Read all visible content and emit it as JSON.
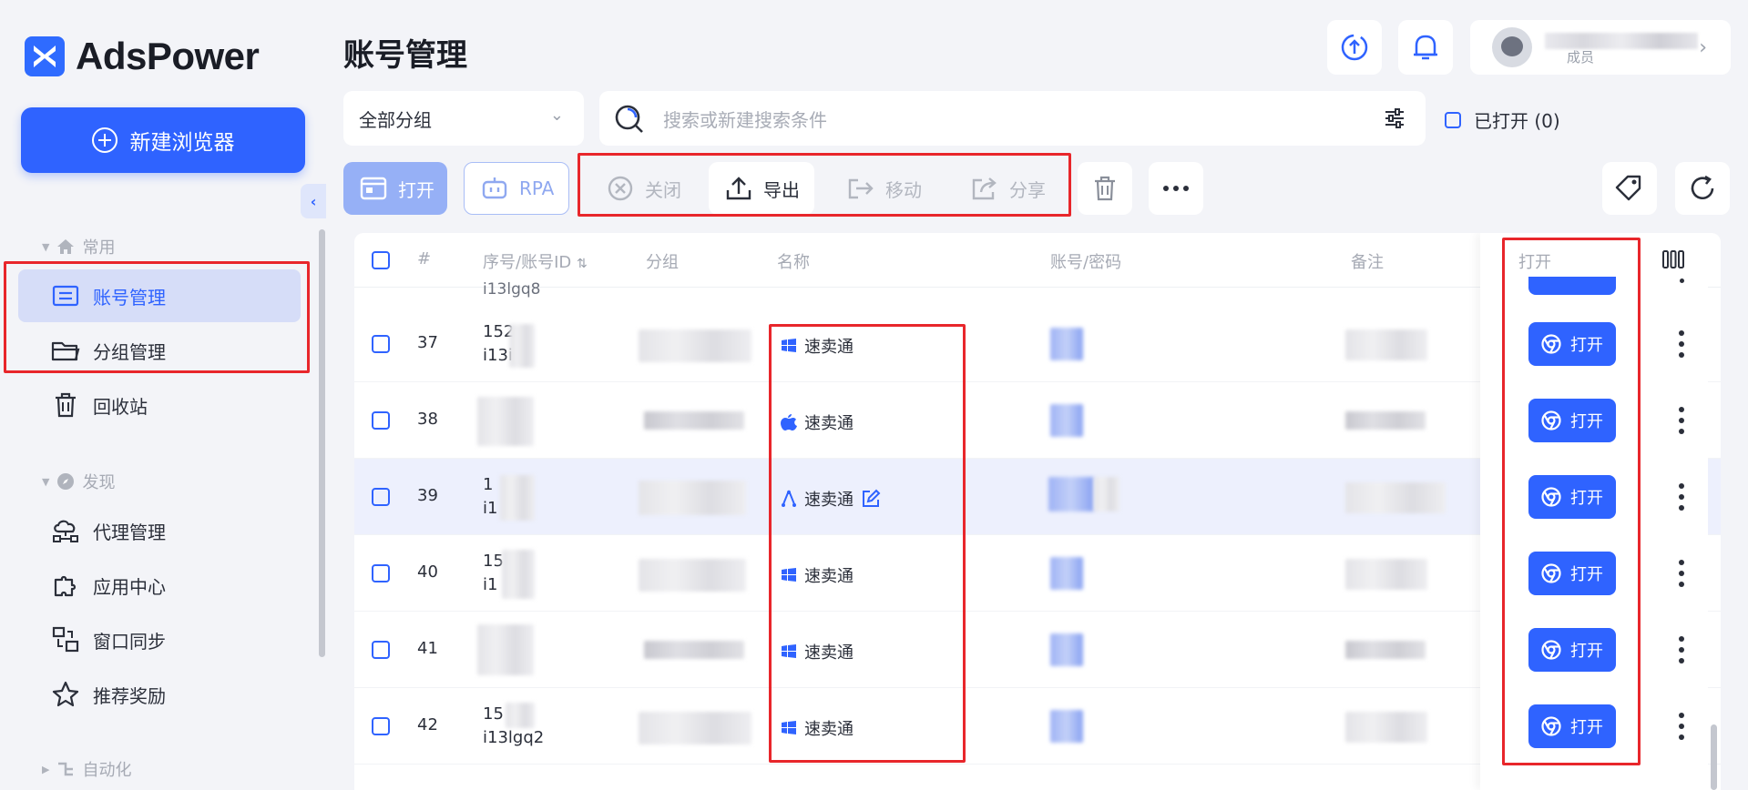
{
  "brand": {
    "name": "AdsPower",
    "accent": "#2f63ff"
  },
  "sidebar": {
    "new_browser_label": "新建浏览器",
    "sections": [
      {
        "title": "常用",
        "items": [
          {
            "label": "账号管理",
            "icon": "list-icon"
          },
          {
            "label": "分组管理",
            "icon": "folder-icon"
          },
          {
            "label": "回收站",
            "icon": "trash-icon"
          }
        ]
      },
      {
        "title": "发现",
        "items": [
          {
            "label": "代理管理",
            "icon": "cloud-network-icon"
          },
          {
            "label": "应用中心",
            "icon": "puzzle-icon"
          },
          {
            "label": "窗口同步",
            "icon": "sync-windows-icon"
          },
          {
            "label": "推荐奖励",
            "icon": "star-icon"
          }
        ]
      },
      {
        "title": "自动化",
        "items": []
      }
    ],
    "active_item": "账号管理"
  },
  "header": {
    "title": "账号管理",
    "user_partial": "成员"
  },
  "filters": {
    "group_select": "全部分组",
    "search_placeholder": "搜索或新建搜索条件",
    "opened_label": "已打开 (0)"
  },
  "toolbar": {
    "open": "打开",
    "rpa": "RPA",
    "close": "关闭",
    "export": "导出",
    "move": "移动",
    "share": "分享"
  },
  "table": {
    "headers": {
      "index": "#",
      "serial": "序号/账号ID",
      "group": "分组",
      "name": "名称",
      "account": "账号/密码",
      "remark": "备注",
      "open": "打开"
    },
    "partial_top_id": "i13lgq8",
    "rows": [
      {
        "index": "37",
        "serial": "152",
        "id": "i13i",
        "os": "windows",
        "name": "速卖通",
        "open": "打开"
      },
      {
        "index": "38",
        "serial": "",
        "id": "",
        "os": "apple",
        "name": "速卖通",
        "open": "打开"
      },
      {
        "index": "39",
        "serial": "1",
        "id": "i1",
        "os": "linux",
        "name": "速卖通",
        "open": "打开"
      },
      {
        "index": "40",
        "serial": "15",
        "id": "i1",
        "os": "windows",
        "name": "速卖通",
        "open": "打开"
      },
      {
        "index": "41",
        "serial": "",
        "id": "",
        "os": "windows",
        "name": "速卖通",
        "open": "打开"
      },
      {
        "index": "42",
        "serial": "15",
        "id": "i13lgq2",
        "os": "windows",
        "name": "速卖通",
        "open": "打开"
      }
    ]
  }
}
